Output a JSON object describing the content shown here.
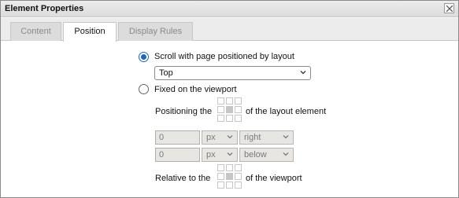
{
  "window": {
    "title": "Element Properties"
  },
  "tabs": [
    {
      "label": "Content",
      "active": false
    },
    {
      "label": "Position",
      "active": true
    },
    {
      "label": "Display Rules",
      "active": false
    }
  ],
  "position": {
    "scroll_option": {
      "label": "Scroll with page positioned by layout",
      "checked": true
    },
    "layout_select": {
      "value": "Top"
    },
    "fixed_option": {
      "label": "Fixed on the viewport",
      "checked": false
    },
    "positioning": {
      "prefix": "Positioning the",
      "suffix": "of the layout element"
    },
    "offset_rows": [
      {
        "value": "0",
        "unit": "px",
        "direction": "right"
      },
      {
        "value": "0",
        "unit": "px",
        "direction": "below"
      }
    ],
    "relative": {
      "prefix": "Relative to the",
      "suffix": "of the viewport"
    }
  },
  "icons": {
    "close": "close-icon",
    "dropdown": "chevron-down-icon"
  },
  "colors": {
    "accent": "#1a66c4",
    "disabled_bg": "#e8e6e2",
    "titlebar_bg": "#dcdcdc"
  }
}
